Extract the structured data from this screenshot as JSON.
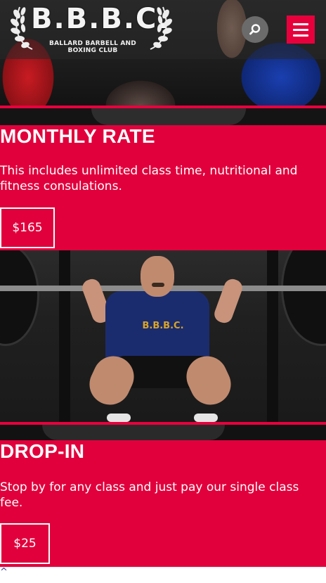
{
  "header": {
    "logo_title": "B.B.B.C.",
    "logo_subtitle": "BALLARD BARBELL AND BOXING CLUB",
    "search_icon": "search-icon",
    "menu_icon": "hamburger-menu-icon",
    "accent_color": "#e1003c"
  },
  "pricing": [
    {
      "title": "MONTHLY RATE",
      "description": "This includes unlimited class time, nutritional and fitness consulations.",
      "price": "$165"
    },
    {
      "title": "DROP-IN",
      "description": "Stop by for any class and just pay our single class fee.",
      "price": "$25"
    }
  ],
  "photo": {
    "shirt_text": "B.B.B.C."
  },
  "footer": {
    "back_to_top": "^"
  }
}
